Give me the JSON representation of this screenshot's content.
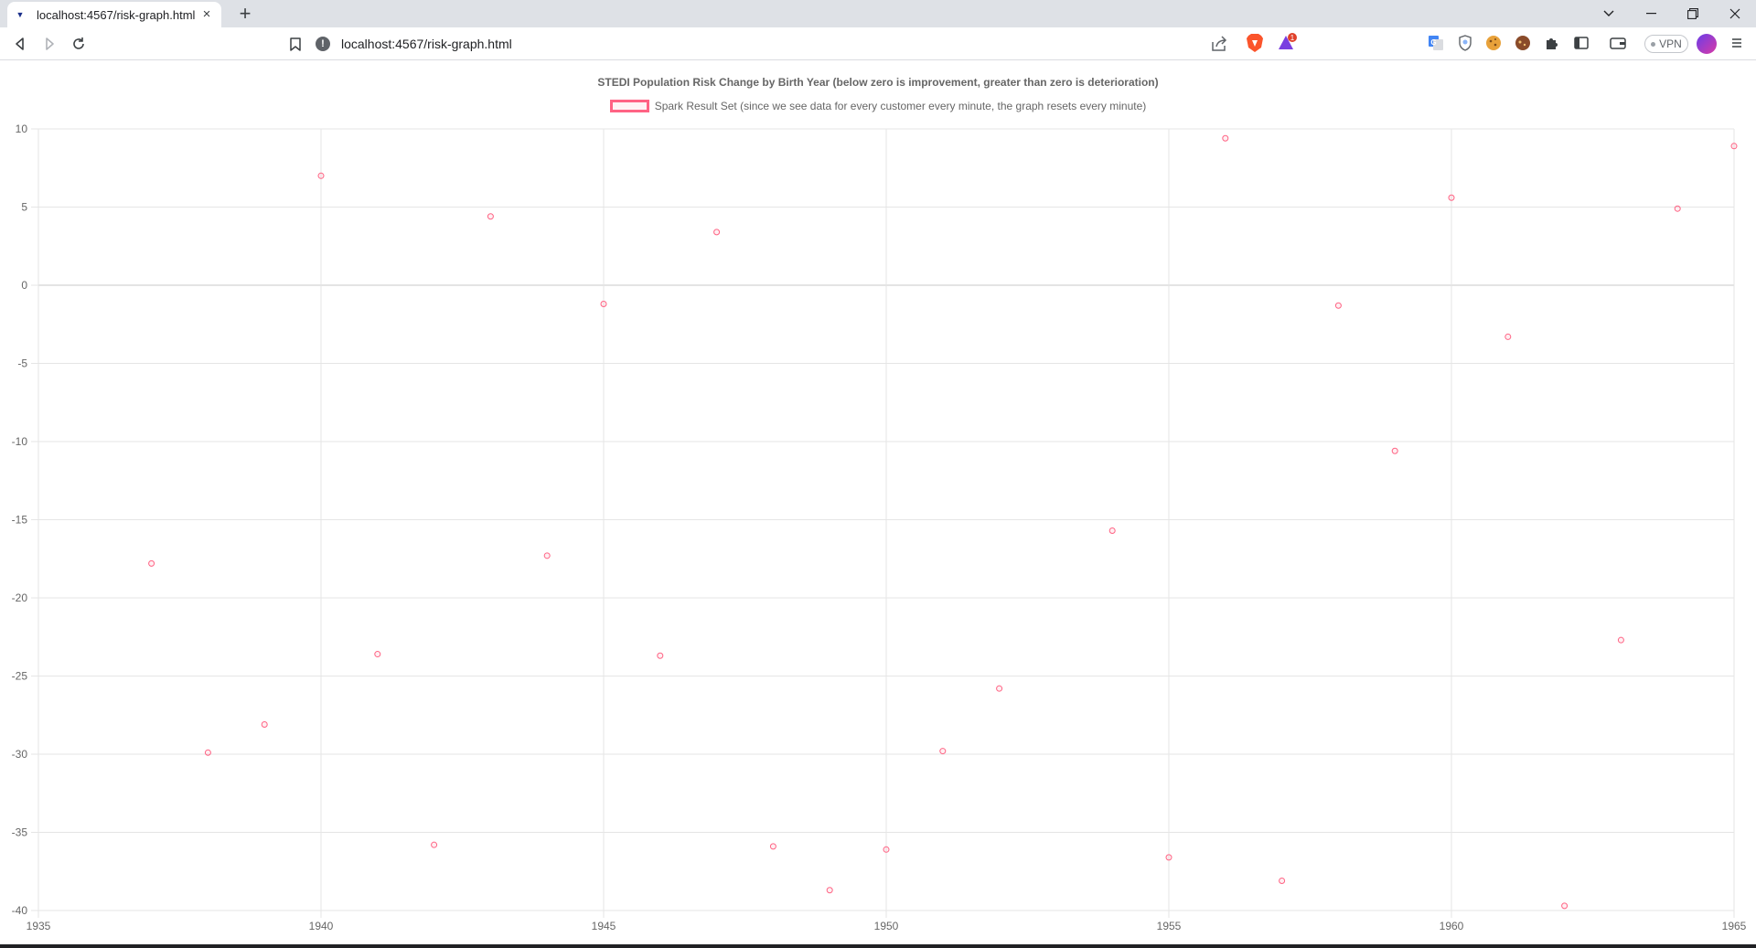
{
  "browser": {
    "tab_title": "localhost:4567/risk-graph.html",
    "url": "localhost:4567/risk-graph.html",
    "vpn_label": "VPN",
    "rewards_badge": "1"
  },
  "colors": {
    "series": "#ff6384",
    "grid": "#e5e5e5",
    "zero_line": "#c8c8c8",
    "text": "#666666"
  },
  "chart_data": {
    "type": "scatter",
    "title": "STEDI Population Risk Change by Birth Year (below zero is improvement, greater than zero is deterioration)",
    "xlabel": "",
    "ylabel": "",
    "xlim": [
      1935,
      1965
    ],
    "ylim": [
      -40,
      10
    ],
    "x_ticks": [
      "1935",
      "1940",
      "1945",
      "1950",
      "1955",
      "1960",
      "1965"
    ],
    "y_ticks": [
      "10",
      "5",
      "0",
      "-5",
      "-10",
      "-15",
      "-20",
      "-25",
      "-30",
      "-35",
      "-40"
    ],
    "grid": true,
    "legend": "top-center",
    "series": [
      {
        "name": "Spark Result Set (since we see data for every customer every minute, the graph resets every minute)",
        "points": [
          {
            "x": 1937,
            "y": -17.8
          },
          {
            "x": 1938,
            "y": -29.9
          },
          {
            "x": 1939,
            "y": -28.1
          },
          {
            "x": 1940,
            "y": 7.0
          },
          {
            "x": 1941,
            "y": -23.6
          },
          {
            "x": 1942,
            "y": -35.8
          },
          {
            "x": 1943,
            "y": 4.4
          },
          {
            "x": 1944,
            "y": -17.3
          },
          {
            "x": 1945,
            "y": -1.2
          },
          {
            "x": 1946,
            "y": -23.7
          },
          {
            "x": 1947,
            "y": 3.4
          },
          {
            "x": 1948,
            "y": -35.9
          },
          {
            "x": 1949,
            "y": -38.7
          },
          {
            "x": 1950,
            "y": -36.1
          },
          {
            "x": 1951,
            "y": -29.8
          },
          {
            "x": 1952,
            "y": -25.8
          },
          {
            "x": 1954,
            "y": -15.7
          },
          {
            "x": 1955,
            "y": -36.6
          },
          {
            "x": 1956,
            "y": 9.4
          },
          {
            "x": 1957,
            "y": -38.1
          },
          {
            "x": 1958,
            "y": -1.3
          },
          {
            "x": 1959,
            "y": -10.6
          },
          {
            "x": 1960,
            "y": 5.6
          },
          {
            "x": 1961,
            "y": -3.3
          },
          {
            "x": 1962,
            "y": -39.7
          },
          {
            "x": 1963,
            "y": -22.7
          },
          {
            "x": 1964,
            "y": 4.9
          },
          {
            "x": 1965,
            "y": 8.9
          }
        ]
      }
    ]
  }
}
